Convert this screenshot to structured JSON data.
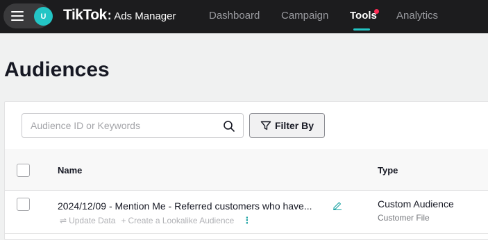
{
  "header": {
    "avatar_initial": "U",
    "logo_main": "TikTok",
    "logo_sub": "Ads Manager",
    "nav": [
      "Dashboard",
      "Campaign",
      "Tools",
      "Analytics"
    ],
    "active_nav": "Tools",
    "accent": "#23c5c5",
    "notification_color": "#fe2c55"
  },
  "page": {
    "title": "Audiences"
  },
  "toolbar": {
    "search_placeholder": "Audience ID or Keywords",
    "filter_label": "Filter By"
  },
  "table": {
    "columns": [
      "Name",
      "Type"
    ],
    "rows": [
      {
        "name": "2024/12/09 - Mention Me - Referred customers who have...",
        "update_label": "Update Data",
        "lookalike_label": "Create a Lookalike Audience",
        "type": "Custom Audience",
        "subtype": "Customer File"
      }
    ]
  }
}
